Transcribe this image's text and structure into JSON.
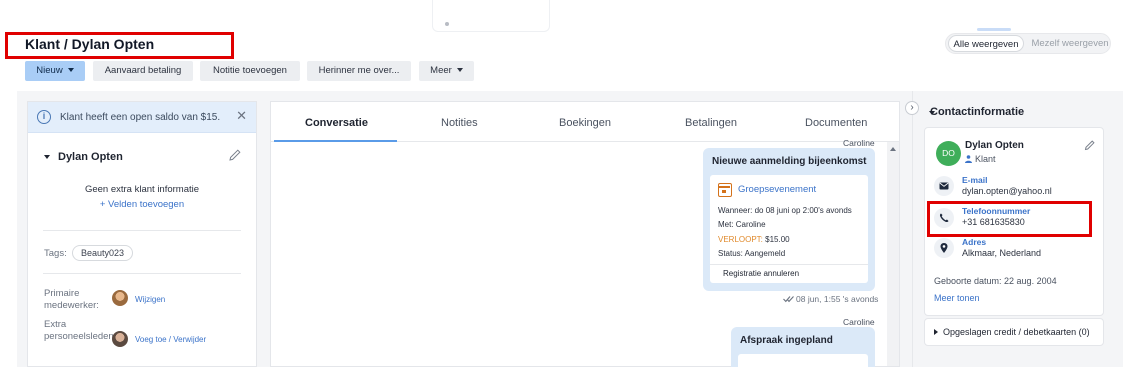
{
  "header": {
    "title": "Klant / Dylan Opten",
    "views": {
      "all": "Alle weergeven",
      "mine": "Mezelf weergeven"
    }
  },
  "toolbar": {
    "new": "Nieuw",
    "accept_payment": "Aanvaard betaling",
    "add_note": "Notitie toevoegen",
    "remind": "Herinner me over...",
    "more": "Meer"
  },
  "left": {
    "alert": "Klant heeft een open saldo van $15.",
    "name": "Dylan Opten",
    "no_info": "Geen extra klant informatie",
    "add_fields": "+ Velden toevoegen",
    "tags_label": "Tags:",
    "tag": "Beauty023",
    "primary_staff_label": "Primaire medewerker:",
    "primary_staff_action": "Wijzigen",
    "extra_staff_label": "Extra personeelsleden:",
    "extra_staff_action": "Voeg toe / Verwijder"
  },
  "center": {
    "tabs": [
      "Conversatie",
      "Notities",
      "Boekingen",
      "Betalingen",
      "Documenten"
    ],
    "sender": "Caroline",
    "message1": {
      "title": "Nieuwe aanmelding bijeenkomst",
      "card_title": "Groepsevenement",
      "when": "Wanneer: do 08 juni op 2:00's avonds",
      "with": "Met: Caroline",
      "expired_label": "VERLOOPT:",
      "expired_value": " $15.00",
      "status": "Status: Aangemeld",
      "action": "Registratie annuleren",
      "timestamp": "08 jun, 1:55 's avonds"
    },
    "message2": {
      "sender": "Caroline",
      "title": "Afspraak ingepland"
    }
  },
  "right": {
    "header": "Contactinformatie",
    "initials": "DO",
    "name": "Dylan Opten",
    "role": "Klant",
    "email_label": "E-mail",
    "email": "dylan.opten@yahoo.nl",
    "phone_label": "Telefoonnummer",
    "phone": "+31 681635830",
    "address_label": "Adres",
    "address": "Alkmaar, Nederland",
    "birth": "Geboorte datum: 22 aug. 2004",
    "more": "Meer tonen",
    "saved_cards": "Opgeslagen credit / debetkaarten (0)"
  },
  "colors": {
    "accent": "#5a9be8",
    "primary_button": "#a9cdf6",
    "link": "#3b73c9",
    "highlight_box": "#e00000",
    "avatar_bg": "#3fae5a",
    "expired": "#e08a2c"
  }
}
